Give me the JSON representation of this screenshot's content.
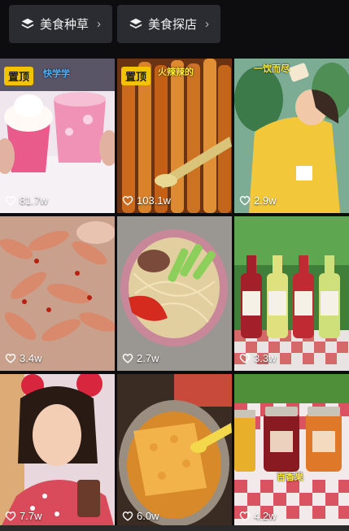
{
  "filters": [
    {
      "label": "美食种草",
      "icon": "layers-icon"
    },
    {
      "label": "美食探店",
      "icon": "layers-icon"
    }
  ],
  "pinned_label": "置顶",
  "colors": {
    "pin_bg": "#f2c300",
    "chip_bg": "#2b2c31",
    "page_bg": "#0d0d0f"
  },
  "videos": [
    {
      "likes": "81.7w",
      "pinned": true,
      "caption": "快学学",
      "subject": "pink ice drinks with whipped cream"
    },
    {
      "likes": "103.1w",
      "pinned": true,
      "caption": "火辣辣的",
      "subject": "spicy fried skewers being brushed with sauce"
    },
    {
      "likes": "2.9w",
      "pinned": false,
      "caption": "一饮而尽",
      "subject": "woman in yellow drinking from a cup"
    },
    {
      "likes": "3.4w",
      "pinned": false,
      "caption": "",
      "subject": "spicy chicken feet"
    },
    {
      "likes": "2.7w",
      "pinned": false,
      "caption": "",
      "subject": "bowl of noodles with beef and tomato"
    },
    {
      "likes": "3.3w",
      "pinned": false,
      "caption": "",
      "subject": "bottles of drinks on checkered table"
    },
    {
      "likes": "7.7w",
      "pinned": false,
      "caption": "",
      "subject": "woman holding a phone"
    },
    {
      "likes": "6.0w",
      "pinned": false,
      "caption": "",
      "subject": "crispy noodle dish in a pot"
    },
    {
      "likes": "4.2w",
      "pinned": false,
      "caption": "百香果",
      "subject": "jars of jam on checkered tablecloth"
    }
  ]
}
